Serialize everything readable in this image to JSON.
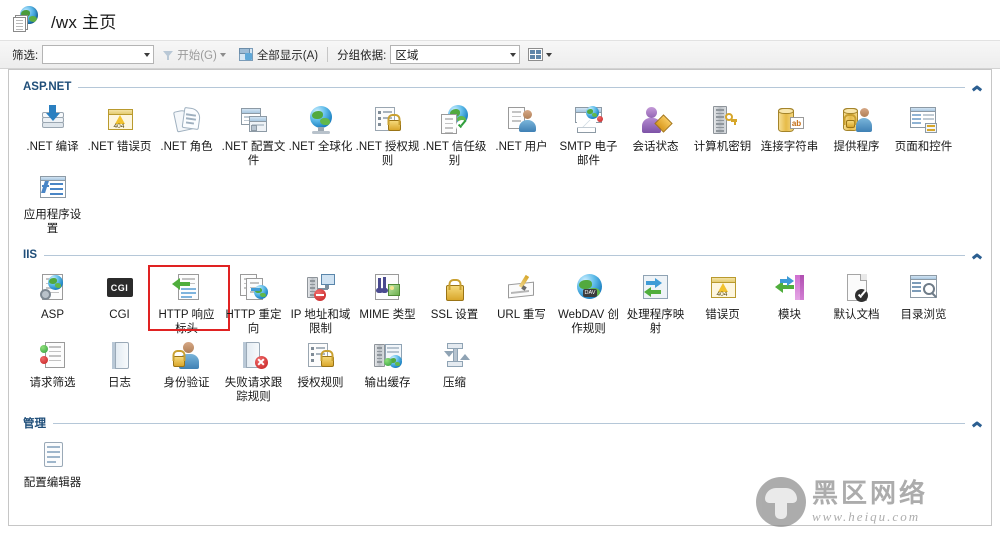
{
  "window": {
    "title": "/wx 主页",
    "title_icon": "site-globe-page-icon"
  },
  "toolbar": {
    "filter_label": "筛选:",
    "filter_value": "",
    "filter_placeholder": "",
    "start_label": "开始(G)",
    "start_icon": "funnel-icon",
    "show_all_label": "全部显示(A)",
    "show_all_icon": "show-all-icon",
    "group_by_label": "分组依据:",
    "group_by_value": "区域",
    "view_icon": "view-grid-icon"
  },
  "sections": [
    {
      "id": "aspnet",
      "title": "ASP.NET",
      "items": [
        {
          "label": ".NET 编译",
          "icon": "net-compilation-icon"
        },
        {
          "label": ".NET 错误页",
          "icon": "net-error-pages-icon"
        },
        {
          "label": ".NET 角色",
          "icon": "net-roles-icon"
        },
        {
          "label": ".NET 配置文件",
          "icon": "net-profile-icon"
        },
        {
          "label": ".NET 全球化",
          "icon": "net-globalization-icon"
        },
        {
          "label": ".NET 授权规则",
          "icon": "net-authorization-rules-icon"
        },
        {
          "label": ".NET 信任级别",
          "icon": "net-trust-levels-icon"
        },
        {
          "label": ".NET 用户",
          "icon": "net-users-icon"
        },
        {
          "label": "SMTP 电子邮件",
          "icon": "smtp-email-icon"
        },
        {
          "label": "会话状态",
          "icon": "session-state-icon"
        },
        {
          "label": "计算机密钥",
          "icon": "machine-key-icon"
        },
        {
          "label": "连接字符串",
          "icon": "connection-strings-icon"
        },
        {
          "label": "提供程序",
          "icon": "providers-icon"
        },
        {
          "label": "页面和控件",
          "icon": "pages-and-controls-icon"
        },
        {
          "label": "应用程序设置",
          "icon": "application-settings-icon"
        }
      ]
    },
    {
      "id": "iis",
      "title": "IIS",
      "items": [
        {
          "label": "ASP",
          "icon": "asp-icon"
        },
        {
          "label": "CGI",
          "icon": "cgi-icon"
        },
        {
          "label": "HTTP 响应标头",
          "icon": "http-response-headers-icon",
          "highlighted": true
        },
        {
          "label": "HTTP 重定向",
          "icon": "http-redirect-icon"
        },
        {
          "label": "IP 地址和域限制",
          "icon": "ip-address-domain-restrictions-icon"
        },
        {
          "label": "MIME 类型",
          "icon": "mime-types-icon"
        },
        {
          "label": "SSL 设置",
          "icon": "ssl-settings-icon"
        },
        {
          "label": "URL 重写",
          "icon": "url-rewrite-icon"
        },
        {
          "label": "WebDAV 创作规则",
          "icon": "webdav-authoring-rules-icon"
        },
        {
          "label": "处理程序映射",
          "icon": "handler-mappings-icon"
        },
        {
          "label": "错误页",
          "icon": "error-pages-icon"
        },
        {
          "label": "模块",
          "icon": "modules-icon"
        },
        {
          "label": "默认文档",
          "icon": "default-document-icon"
        },
        {
          "label": "目录浏览",
          "icon": "directory-browsing-icon"
        },
        {
          "label": "请求筛选",
          "icon": "request-filtering-icon"
        },
        {
          "label": "日志",
          "icon": "logging-icon"
        },
        {
          "label": "身份验证",
          "icon": "authentication-icon"
        },
        {
          "label": "失败请求跟踪规则",
          "icon": "failed-request-tracing-rules-icon"
        },
        {
          "label": "授权规则",
          "icon": "authorization-rules-icon"
        },
        {
          "label": "输出缓存",
          "icon": "output-caching-icon"
        },
        {
          "label": "压缩",
          "icon": "compression-icon"
        }
      ]
    },
    {
      "id": "management",
      "title": "管理",
      "items": [
        {
          "label": "配置编辑器",
          "icon": "configuration-editor-icon"
        }
      ]
    }
  ],
  "watermark": {
    "brand": "黑区网络",
    "url": "www.heiqu.com",
    "logo": "mushroom-logo"
  },
  "colors": {
    "section_title": "#1f4e79",
    "highlight": "#e02222",
    "watermark": "#8d8d8d"
  }
}
